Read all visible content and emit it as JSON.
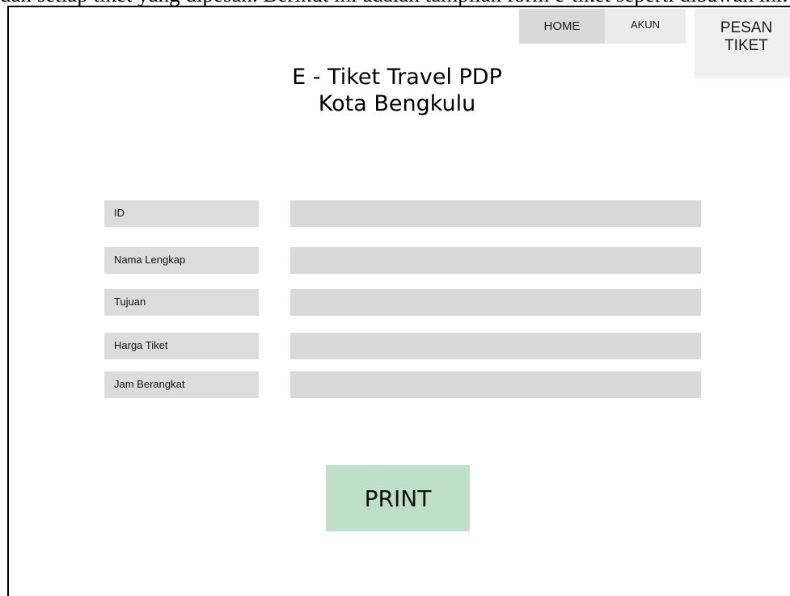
{
  "caption": "dan setiap tiket yang dipesan. Berikut ini adalah tampilan form e-tiket seperti dibawah ini: contohnya",
  "nav": {
    "home_label": "HOME",
    "akun_label": "AKUN",
    "pesan_tiket_label_line1": "PESAN",
    "pesan_tiket_label_line2": "TIKET"
  },
  "title": {
    "line1": "E - Tiket Travel PDP",
    "line2": "Kota Bengkulu"
  },
  "form": {
    "fields": [
      {
        "label": "ID",
        "value": ""
      },
      {
        "label": "Nama Lengkap",
        "value": ""
      },
      {
        "label": "Tujuan",
        "value": ""
      },
      {
        "label": "Harga Tiket",
        "value": ""
      },
      {
        "label": "Jam Berangkat",
        "value": ""
      }
    ]
  },
  "print_label": "PRINT",
  "colors": {
    "nav_home": "#d9d9d9",
    "nav_akun": "#ececec",
    "nav_pesan": "#efefef",
    "field_bg": "#d9d9d9",
    "print_bg": "#bfe0c8"
  }
}
